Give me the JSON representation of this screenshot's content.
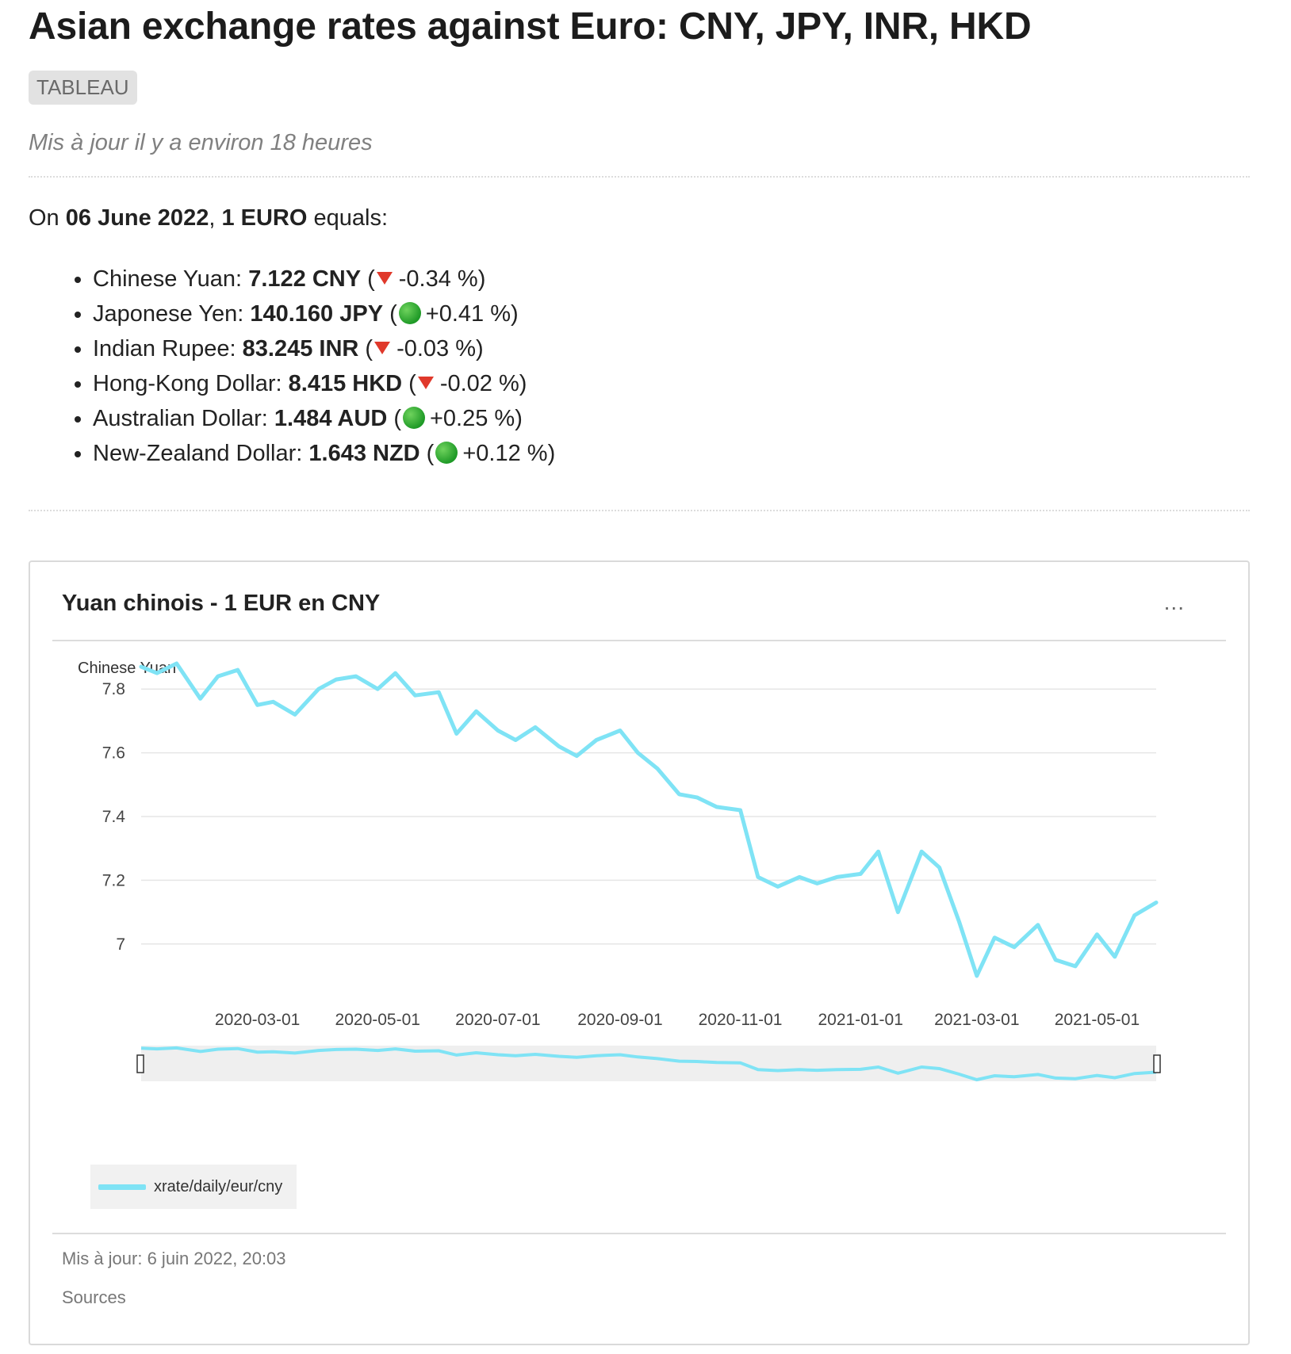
{
  "header": {
    "title": "Asian exchange rates against Euro: CNY, JPY, INR, HKD",
    "tag": "TABLEAU",
    "updated": "Mis à jour il y a environ 18 heures"
  },
  "intro": {
    "prefix": "On ",
    "date": "06 June 2022",
    "sep": ", ",
    "amount": "1 EURO",
    "suffix": " equals:"
  },
  "rates": [
    {
      "label": "Chinese Yuan: ",
      "value": "7.122 CNY",
      "direction": "down",
      "change": "-0.34 %"
    },
    {
      "label": "Japonese Yen: ",
      "value": "140.160 JPY",
      "direction": "up",
      "change": "+0.41 %"
    },
    {
      "label": "Indian Rupee: ",
      "value": "83.245 INR",
      "direction": "down",
      "change": "-0.03 %"
    },
    {
      "label": "Hong-Kong Dollar: ",
      "value": "8.415 HKD",
      "direction": "down",
      "change": "-0.02 %"
    },
    {
      "label": "Australian Dollar: ",
      "value": "1.484 AUD",
      "direction": "up",
      "change": "+0.25 %"
    },
    {
      "label": "New-Zealand Dollar: ",
      "value": "1.643 NZD",
      "direction": "up",
      "change": "+0.12 %"
    }
  ],
  "card": {
    "title": "Yuan chinois - 1 EUR en CNY",
    "menu": "...",
    "footer_updated": "Mis à jour: 6 juin 2022, 20:03",
    "footer_sources": "Sources"
  },
  "chart_data": {
    "type": "line",
    "ylabel": "Chinese Yuan",
    "y_ticks": [
      7,
      7.2,
      7.4,
      7.6,
      7.8
    ],
    "y_tick_labels": [
      "7",
      "7.2",
      "7.4",
      "7.6",
      "7.8"
    ],
    "ylim": [
      6.9,
      7.9
    ],
    "x_tick_labels": [
      "2020-03-01",
      "2020-05-01",
      "2020-07-01",
      "2020-09-01",
      "2020-11-01",
      "2021-01-01",
      "2021-03-01",
      "2021-05-01"
    ],
    "xlim": [
      "2020-01-02",
      "2021-05-31"
    ],
    "grid": true,
    "legend": "bottom-left",
    "color": "#7fe3f5",
    "series": [
      {
        "name": "xrate/daily/eur/cny",
        "x": [
          "2020-01-02",
          "2020-01-10",
          "2020-01-20",
          "2020-02-01",
          "2020-02-10",
          "2020-02-20",
          "2020-03-01",
          "2020-03-09",
          "2020-03-20",
          "2020-04-01",
          "2020-04-10",
          "2020-04-20",
          "2020-05-01",
          "2020-05-10",
          "2020-05-20",
          "2020-06-01",
          "2020-06-10",
          "2020-06-20",
          "2020-07-01",
          "2020-07-10",
          "2020-07-20",
          "2020-08-01",
          "2020-08-10",
          "2020-08-20",
          "2020-09-01",
          "2020-09-10",
          "2020-09-20",
          "2020-10-01",
          "2020-10-10",
          "2020-10-20",
          "2020-11-01",
          "2020-11-10",
          "2020-11-20",
          "2020-12-01",
          "2020-12-10",
          "2020-12-20",
          "2021-01-01",
          "2021-01-10",
          "2021-01-20",
          "2021-02-01",
          "2021-02-10",
          "2021-02-20",
          "2021-03-01",
          "2021-03-10",
          "2021-03-20",
          "2021-04-01",
          "2021-04-10",
          "2021-04-20",
          "2021-05-01",
          "2021-05-10",
          "2021-05-20",
          "2021-05-31"
        ],
        "y": [
          7.87,
          7.85,
          7.88,
          7.77,
          7.84,
          7.86,
          7.75,
          7.76,
          7.72,
          7.8,
          7.83,
          7.84,
          7.8,
          7.85,
          7.78,
          7.79,
          7.66,
          7.73,
          7.67,
          7.64,
          7.68,
          7.62,
          7.59,
          7.64,
          7.67,
          7.6,
          7.55,
          7.47,
          7.46,
          7.43,
          7.42,
          7.21,
          7.18,
          7.21,
          7.19,
          7.21,
          7.22,
          7.29,
          7.1,
          7.29,
          7.24,
          7.07,
          6.9,
          7.02,
          6.99,
          7.06,
          6.95,
          6.93,
          7.03,
          6.96,
          7.09,
          7.13
        ]
      }
    ]
  }
}
